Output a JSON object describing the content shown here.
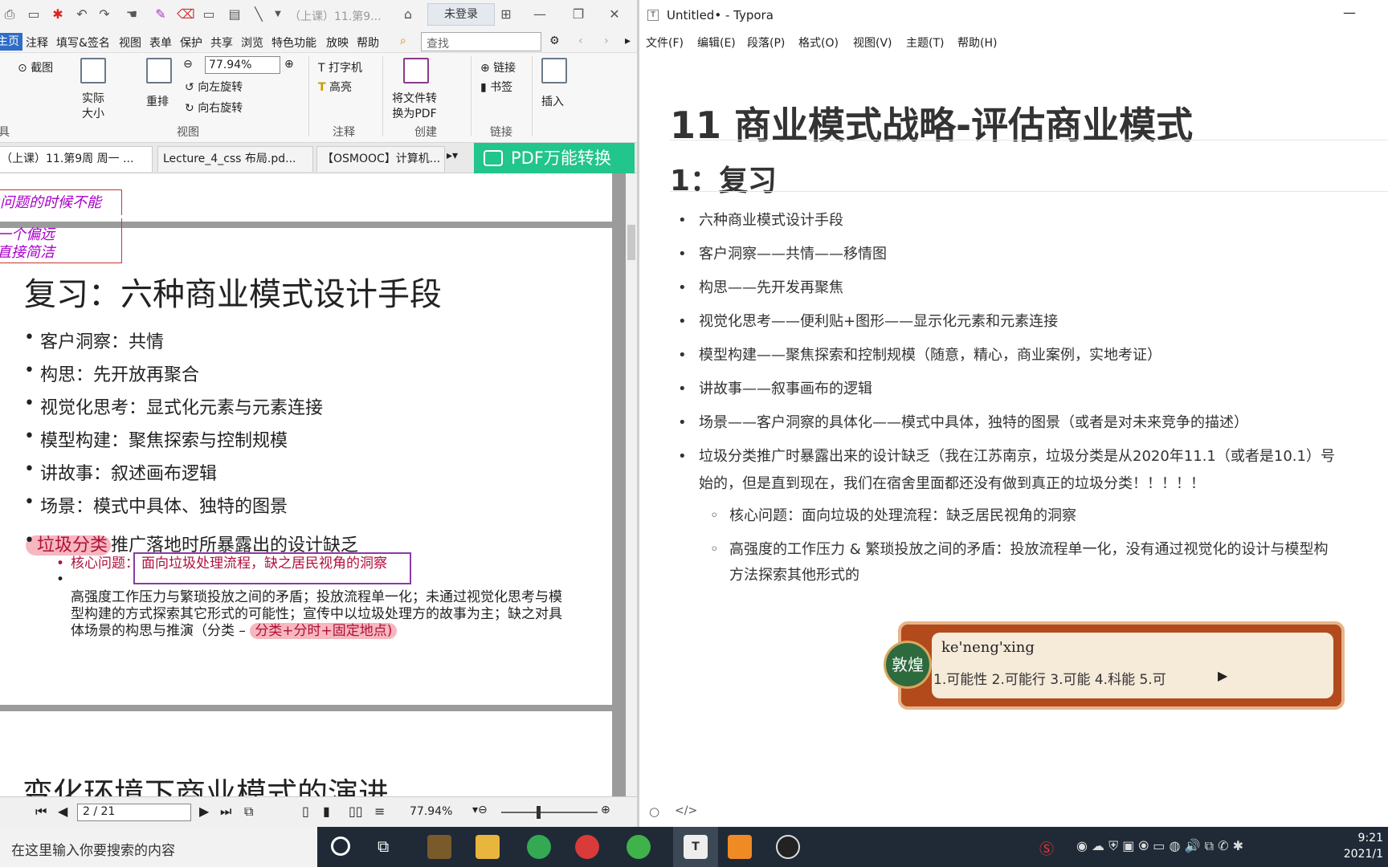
{
  "pdf": {
    "title_fragment": "（上课）11.第9...",
    "login_label": "未登录",
    "menu": [
      "主页",
      "注释",
      "填写&签名",
      "视图",
      "表单",
      "保护",
      "共享",
      "浏览",
      "特色功能",
      "放映",
      "帮助"
    ],
    "search_placeholder": "查找",
    "ribbon": {
      "screenshot": "截图",
      "actual_size": "实际\n大小",
      "reflow": "重排",
      "zoom_value": "77.94%",
      "rotate_left": "向左旋转",
      "rotate_right": "向右旋转",
      "typewriter": "打字机",
      "highlight": "高亮",
      "convert_to_pdf": "将文件转\n换为PDF",
      "link": "链接",
      "bookmark": "书签",
      "insert": "插入",
      "groups": {
        "tools": "具",
        "view": "视图",
        "annotate": "注释",
        "create": "创建",
        "links": "链接"
      }
    },
    "tabs": [
      "（上课）11.第9周 周一 ...",
      "Lecture_4_css 布局.pd...",
      "【OSMOOC】计算机..."
    ],
    "pdf_converter_label": "PDF万能转换",
    "handwriting_top": "问题的时候不能",
    "handwriting_mid": "一个偏远",
    "handwriting_bottom": "直接简洁",
    "slide": {
      "title": "复习：六种商业模式设计手段",
      "bullets": [
        "客户洞察：共情",
        "构思：先开放再聚合",
        "视觉化思考：显式化元素与元素连接",
        "模型构建：聚焦探索与控制规模",
        "讲故事：叙述画布逻辑",
        "场景：模式中具体、独特的图景"
      ],
      "last_bullet_highlight": "垃圾分类",
      "last_bullet_rest": "推广落地时所暴露出的设计缺乏",
      "sub1_label": "核心问题：",
      "sub1_text": "面向垃圾处理流程，缺之居民视角的洞察",
      "sub2_text": "高强度工作压力与繁琐投放之间的矛盾；投放流程单一化；未通过视觉化思考与模型构建的方式探索其它形式的可能性；宣传中以垃圾处理方的故事为主；缺之对具体场景的构思与推演（分类 – ",
      "sub2_highlight": "分类+分时+固定地点)",
      "next_title": "变化环境下商业模式的演进"
    },
    "statusbar": {
      "page": "2 / 21",
      "zoom": "77.94%"
    }
  },
  "typora": {
    "window_title": "Untitled• - Typora",
    "menu": [
      "文件(F)",
      "编辑(E)",
      "段落(P)",
      "格式(O)",
      "视图(V)",
      "主题(T)",
      "帮助(H)"
    ],
    "h1": "11 商业模式战略-评估商业模式",
    "h2": "1：复习",
    "items": [
      "六种商业模式设计手段",
      "客户洞察——共情——移情图",
      "构思——先开发再聚焦",
      "视觉化思考——便利贴+图形——显示化元素和元素连接",
      "模型构建——聚焦探索和控制规模（随意，精心，商业案例，实地考证）",
      "讲故事——叙事画布的逻辑",
      "场景——客户洞察的具体化——模式中具体，独特的图景（或者是对未来竞争的描述）"
    ],
    "item8_line1": "垃圾分类推广时暴露出来的设计缺乏（我在江苏南京，垃圾分类是从2020年11.1（或者是10.1）号",
    "item8_line2": "始的，但是直到现在，我们在宿舍里面都还没有做到真正的垃圾分类！！！！！",
    "sub1": "核心问题：面向垃圾的处理流程：缺乏居民视角的洞察",
    "sub2_line1": "高强度的工作压力 & 繁琐投放之间的矛盾：投放流程单一化，没有通过视觉化的设计与模型构",
    "sub2_line2": "方法探索其他形式的"
  },
  "ime": {
    "pinyin": "ke'neng'xing",
    "candidates": "1.可能性  2.可能行  3.可能  4.科能  5.可",
    "badge": "敦煌"
  },
  "taskbar": {
    "search_placeholder": "在这里输入你要搜索的内容",
    "time": "9:21",
    "date": "2021/1"
  }
}
